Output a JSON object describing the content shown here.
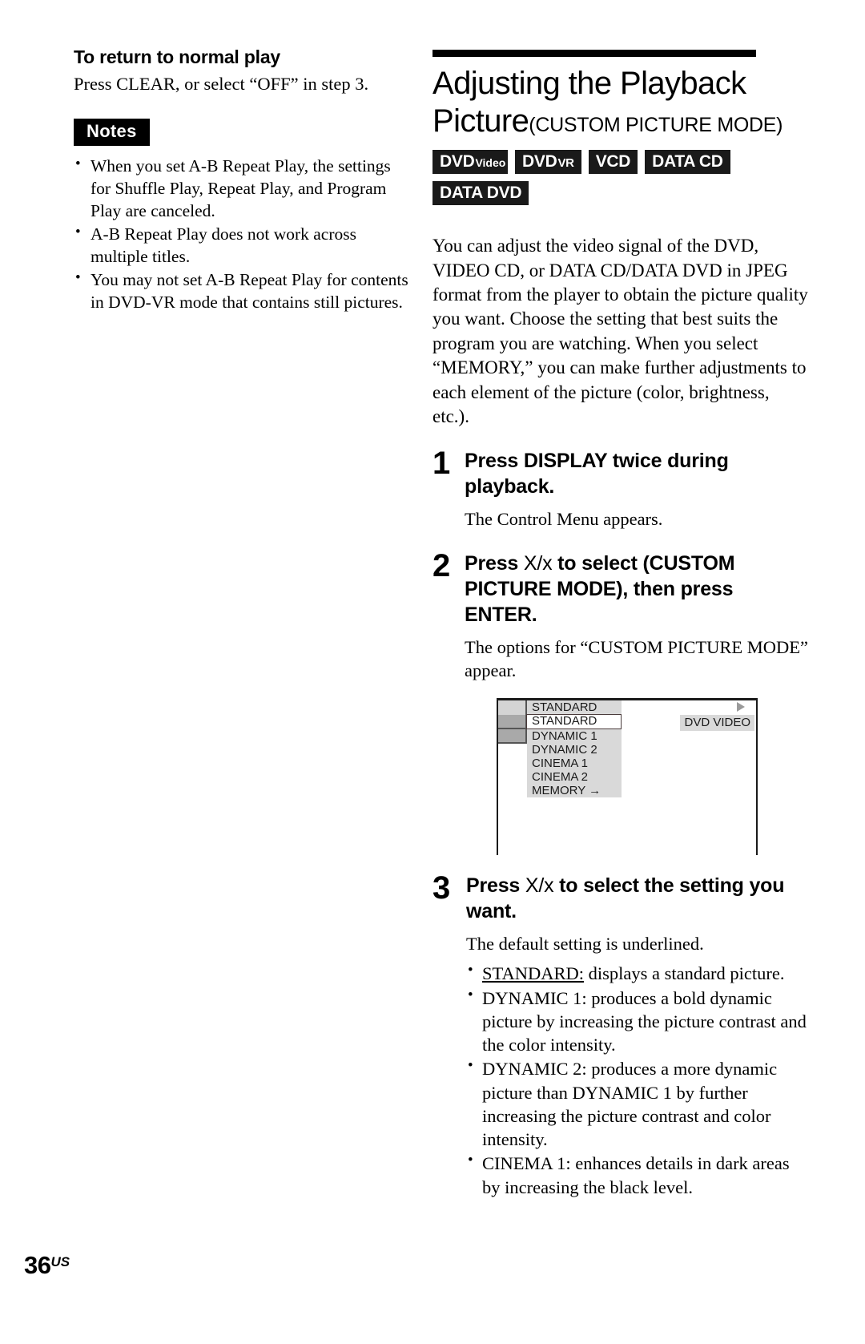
{
  "left_column": {
    "subheading": "To return to normal play",
    "intro_line": "Press CLEAR, or select “OFF” in step 3.",
    "notes_label": "Notes",
    "notes": [
      "When you set A-B Repeat Play, the settings for Shuffle Play, Repeat Play, and Program Play are canceled.",
      "A-B Repeat Play does not work across multiple titles.",
      "You may not set A-B Repeat Play for contents in DVD-VR mode that contains still pictures."
    ]
  },
  "right_column": {
    "title_main": "Adjusting the Playback Picture",
    "title_qualifier": "(CUSTOM PICTURE MODE)",
    "format_badges": [
      {
        "big": "DVD",
        "small": "Video",
        "style": "mixed"
      },
      {
        "big": "DVD",
        "small": "VR",
        "style": "mixed"
      },
      {
        "big": "VCD",
        "small": "",
        "style": "solo"
      },
      {
        "big": "DATA CD",
        "small": "",
        "style": "solo"
      },
      {
        "big": "DATA DVD",
        "small": "",
        "style": "solo"
      }
    ],
    "intro_paragraph": "You can adjust the video signal of the DVD, VIDEO CD, or DATA CD/DATA DVD in JPEG format from the player to obtain the picture quality you want. Choose the setting that best suits the program you are watching. When you select “MEMORY,” you can make further adjustments to each element of the picture (color, brightness, etc.).",
    "steps": [
      {
        "number": "1",
        "title_pre": "Press DISPLAY twice during playback.",
        "keys": "",
        "title_post": "",
        "note": "The Control Menu appears."
      },
      {
        "number": "2",
        "title_pre": "Press ",
        "keys": "X/x",
        "title_post": " to select (CUSTOM PICTURE MODE), then press ENTER.",
        "note": "The options for “CUSTOM PICTURE MODE” appear."
      },
      {
        "number": "3",
        "title_pre": "Press ",
        "keys": "X/x",
        "title_post": " to select the setting you want.",
        "note": "The default setting is underlined."
      }
    ],
    "osd": {
      "header_item": "STANDARD",
      "disc_label": "DVD VIDEO",
      "options": [
        "STANDARD",
        "DYNAMIC 1",
        "DYNAMIC 2",
        "CINEMA 1",
        "CINEMA 2",
        "MEMORY →"
      ],
      "selected_index": 0
    },
    "settings": [
      {
        "name": "STANDARD:",
        "underline": true,
        "description": " displays a standard picture."
      },
      {
        "name": "DYNAMIC 1:",
        "underline": false,
        "description": " produces a bold dynamic picture by increasing the picture contrast and the color intensity."
      },
      {
        "name": "DYNAMIC 2:",
        "underline": false,
        "description": " produces a more dynamic picture than DYNAMIC 1 by further increasing the picture contrast and color intensity."
      },
      {
        "name": "CINEMA 1:",
        "underline": false,
        "description": " enhances details in dark areas by increasing the black level."
      }
    ]
  },
  "footer": {
    "page_number": "36",
    "page_suffix": "US"
  }
}
